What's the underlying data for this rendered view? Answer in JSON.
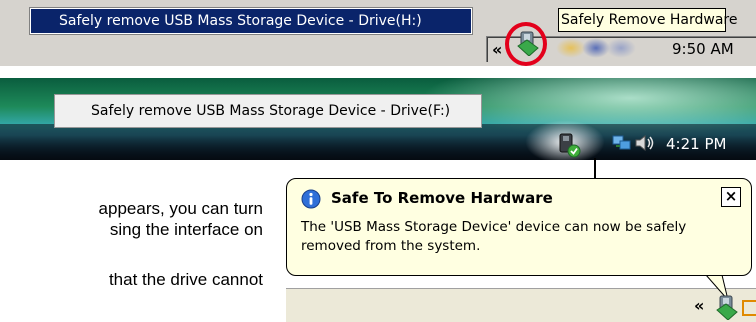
{
  "panel1": {
    "menu_item": "Safely remove USB Mass Storage Device - Drive(H:)",
    "tooltip": "Safely Remove Hardware",
    "chevron": "«",
    "clock": "9:50 AM",
    "icons": [
      "usb-drive-icon"
    ],
    "highlight_color": "#e3001b"
  },
  "panel2": {
    "menu_item": "Safely remove USB Mass Storage Device - Drive(F:)",
    "clock": "4:21 PM",
    "icons": [
      "usb-drive-icon",
      "network-icon",
      "volume-icon"
    ]
  },
  "body_text": {
    "line1": "appears, you can turn",
    "line2": "sing the interface on",
    "line3": "that the drive cannot"
  },
  "balloon": {
    "title": "Safe To Remove Hardware",
    "close": "×",
    "message_line1": "The 'USB Mass Storage Device' device can now be safely",
    "message_line2": "removed from the system.",
    "chevron": "«",
    "icons": [
      "info-icon",
      "usb-drive-icon"
    ]
  }
}
